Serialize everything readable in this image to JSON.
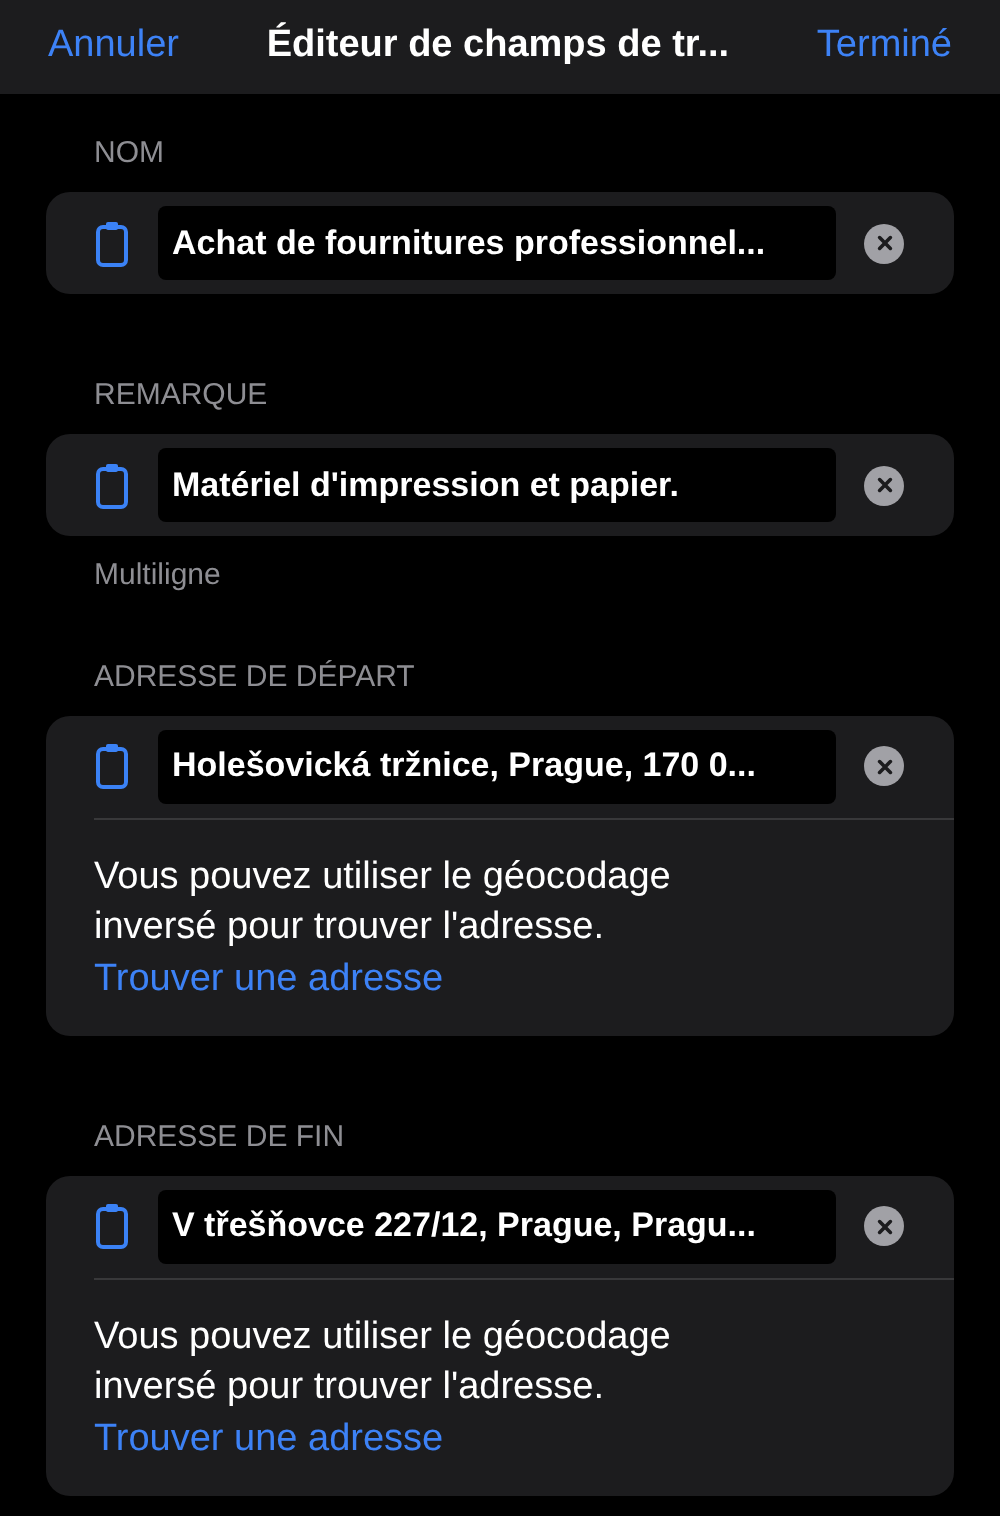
{
  "nav": {
    "cancel": "Annuler",
    "title": "Éditeur de champs de tr...",
    "done": "Terminé"
  },
  "sections": [
    {
      "kind": "field",
      "header": "NOM",
      "value": "Achat de fournitures professionnel..."
    },
    {
      "kind": "field",
      "header": "REMARQUE",
      "value": "Matériel d'impression et papier.",
      "footer": "Multiligne"
    },
    {
      "kind": "address",
      "header": "ADRESSE DE DÉPART",
      "value": "Holešovická tržnice, Prague, 170 0...",
      "hint": "Vous pouvez utiliser le géocodage inversé pour trouver l'adresse.",
      "link": "Trouver une adresse"
    },
    {
      "kind": "address",
      "header": "ADRESSE DE FIN",
      "value": "V třešňovce 227/12, Prague, Pragu...",
      "hint": "Vous pouvez utiliser le géocodage inversé pour trouver l'adresse.",
      "link": "Trouver une adresse"
    }
  ]
}
